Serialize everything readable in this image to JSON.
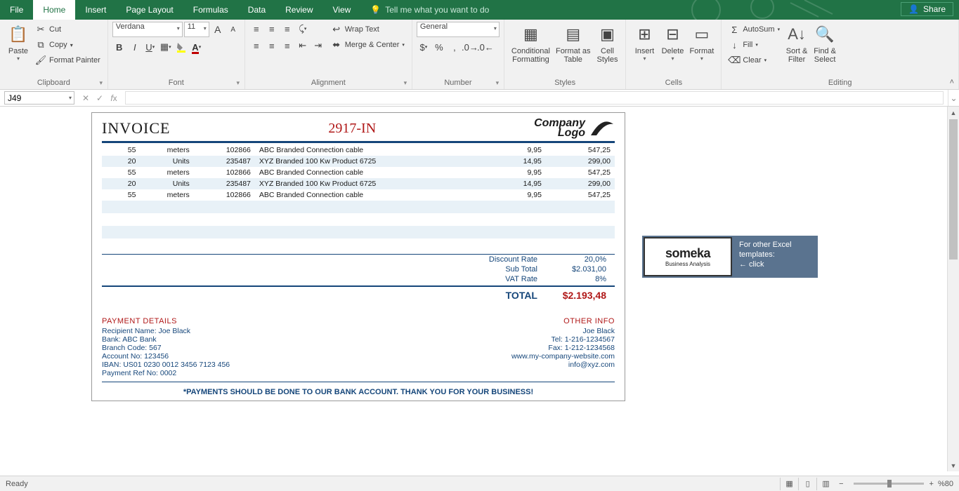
{
  "tabs": {
    "file": "File",
    "home": "Home",
    "insert": "Insert",
    "page_layout": "Page Layout",
    "formulas": "Formulas",
    "data": "Data",
    "review": "Review",
    "view": "View",
    "tell_me": "Tell me what you want to do"
  },
  "share": "Share",
  "ribbon": {
    "clipboard": {
      "label": "Clipboard",
      "paste": "Paste",
      "cut": "Cut",
      "copy": "Copy",
      "format_painter": "Format Painter"
    },
    "font": {
      "label": "Font",
      "name": "Verdana",
      "size": "11",
      "grow": "A",
      "shrink": "A"
    },
    "alignment": {
      "label": "Alignment",
      "wrap": "Wrap Text",
      "merge": "Merge & Center"
    },
    "number": {
      "label": "Number",
      "format": "General"
    },
    "styles": {
      "label": "Styles",
      "cf": "Conditional\nFormatting",
      "fat": "Format as\nTable",
      "cs": "Cell\nStyles"
    },
    "cells": {
      "label": "Cells",
      "insert": "Insert",
      "delete": "Delete",
      "format": "Format"
    },
    "editing": {
      "label": "Editing",
      "autosum": "AutoSum",
      "fill": "Fill",
      "clear": "Clear",
      "sort": "Sort &\nFilter",
      "find": "Find &\nSelect"
    }
  },
  "namebox": "J49",
  "invoice": {
    "title": "INVOICE",
    "number": "2917-IN",
    "logo_top": "Company",
    "logo_bot": "Logo",
    "rows": [
      {
        "qty": "55",
        "unit": "meters",
        "code": "102866",
        "desc": "ABC Branded Connection cable",
        "price": "9,95",
        "total": "547,25"
      },
      {
        "qty": "20",
        "unit": "Units",
        "code": "235487",
        "desc": "XYZ Branded 100 Kw Product 6725",
        "price": "14,95",
        "total": "299,00"
      },
      {
        "qty": "55",
        "unit": "meters",
        "code": "102866",
        "desc": "ABC Branded Connection cable",
        "price": "9,95",
        "total": "547,25"
      },
      {
        "qty": "20",
        "unit": "Units",
        "code": "235487",
        "desc": "XYZ Branded 100 Kw Product 6725",
        "price": "14,95",
        "total": "299,00"
      },
      {
        "qty": "55",
        "unit": "meters",
        "code": "102866",
        "desc": "ABC Branded Connection cable",
        "price": "9,95",
        "total": "547,25"
      }
    ],
    "totals": {
      "discount_label": "Discount Rate",
      "discount_val": "20,0%",
      "sub_label": "Sub Total",
      "sub_val": "$2.031,00",
      "vat_label": "VAT Rate",
      "vat_val": "8%",
      "total_label": "TOTAL",
      "total_val": "$2.193,48"
    },
    "payment": {
      "heading": "PAYMENT DETAILS",
      "l1": "Recipient Name: Joe Black",
      "l2": "Bank: ABC Bank",
      "l3": "Branch Code: 567",
      "l4": "Account No: 123456",
      "l5": "IBAN: US01 0230 0012 3456 7123 456",
      "l6": "Payment Ref No: 0002"
    },
    "other": {
      "heading": "OTHER INFO",
      "l1": "Joe Black",
      "l2": "Tel: 1-216-1234567",
      "l3": "Fax: 1-212-1234568",
      "l4": "www.my-company-website.com",
      "l5": "info@xyz.com"
    },
    "footnote": "*PAYMENTS SHOULD BE DONE TO OUR BANK ACCOUNT. THANK YOU FOR YOUR BUSINESS!"
  },
  "promo": {
    "brand": "someka",
    "sub": "Business Analysis",
    "line1": "For other Excel",
    "line2": "templates:",
    "line3": "← click"
  },
  "status": {
    "ready": "Ready",
    "zoom": "%80"
  }
}
